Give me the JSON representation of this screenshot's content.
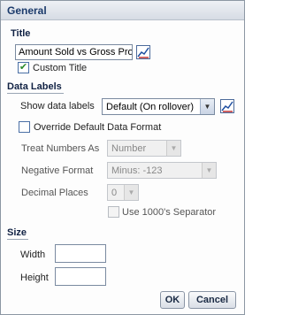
{
  "dialog": {
    "header": "General",
    "title_section": {
      "heading": "Title",
      "title_value": "Amount Sold vs Gross Pro",
      "custom_title_label": "Custom Title",
      "custom_title_checked": true
    },
    "data_labels": {
      "heading": "Data Labels",
      "show_label": "Show data labels",
      "show_value": "Default (On rollover)",
      "override_label": "Override Default Data Format",
      "override_checked": false,
      "treat_numbers_label": "Treat Numbers As",
      "treat_numbers_value": "Number",
      "negative_format_label": "Negative Format",
      "negative_format_value": "Minus: -123",
      "decimal_places_label": "Decimal Places",
      "decimal_places_value": "0",
      "separator_label": "Use 1000's Separator",
      "separator_checked": false
    },
    "size_section": {
      "heading": "Size",
      "width_label": "Width",
      "width_value": "",
      "height_label": "Height",
      "height_value": ""
    },
    "buttons": {
      "ok": "OK",
      "cancel": "Cancel"
    }
  },
  "icons": {
    "title_format": "format-edit-icon",
    "labels_format": "format-edit-icon"
  }
}
